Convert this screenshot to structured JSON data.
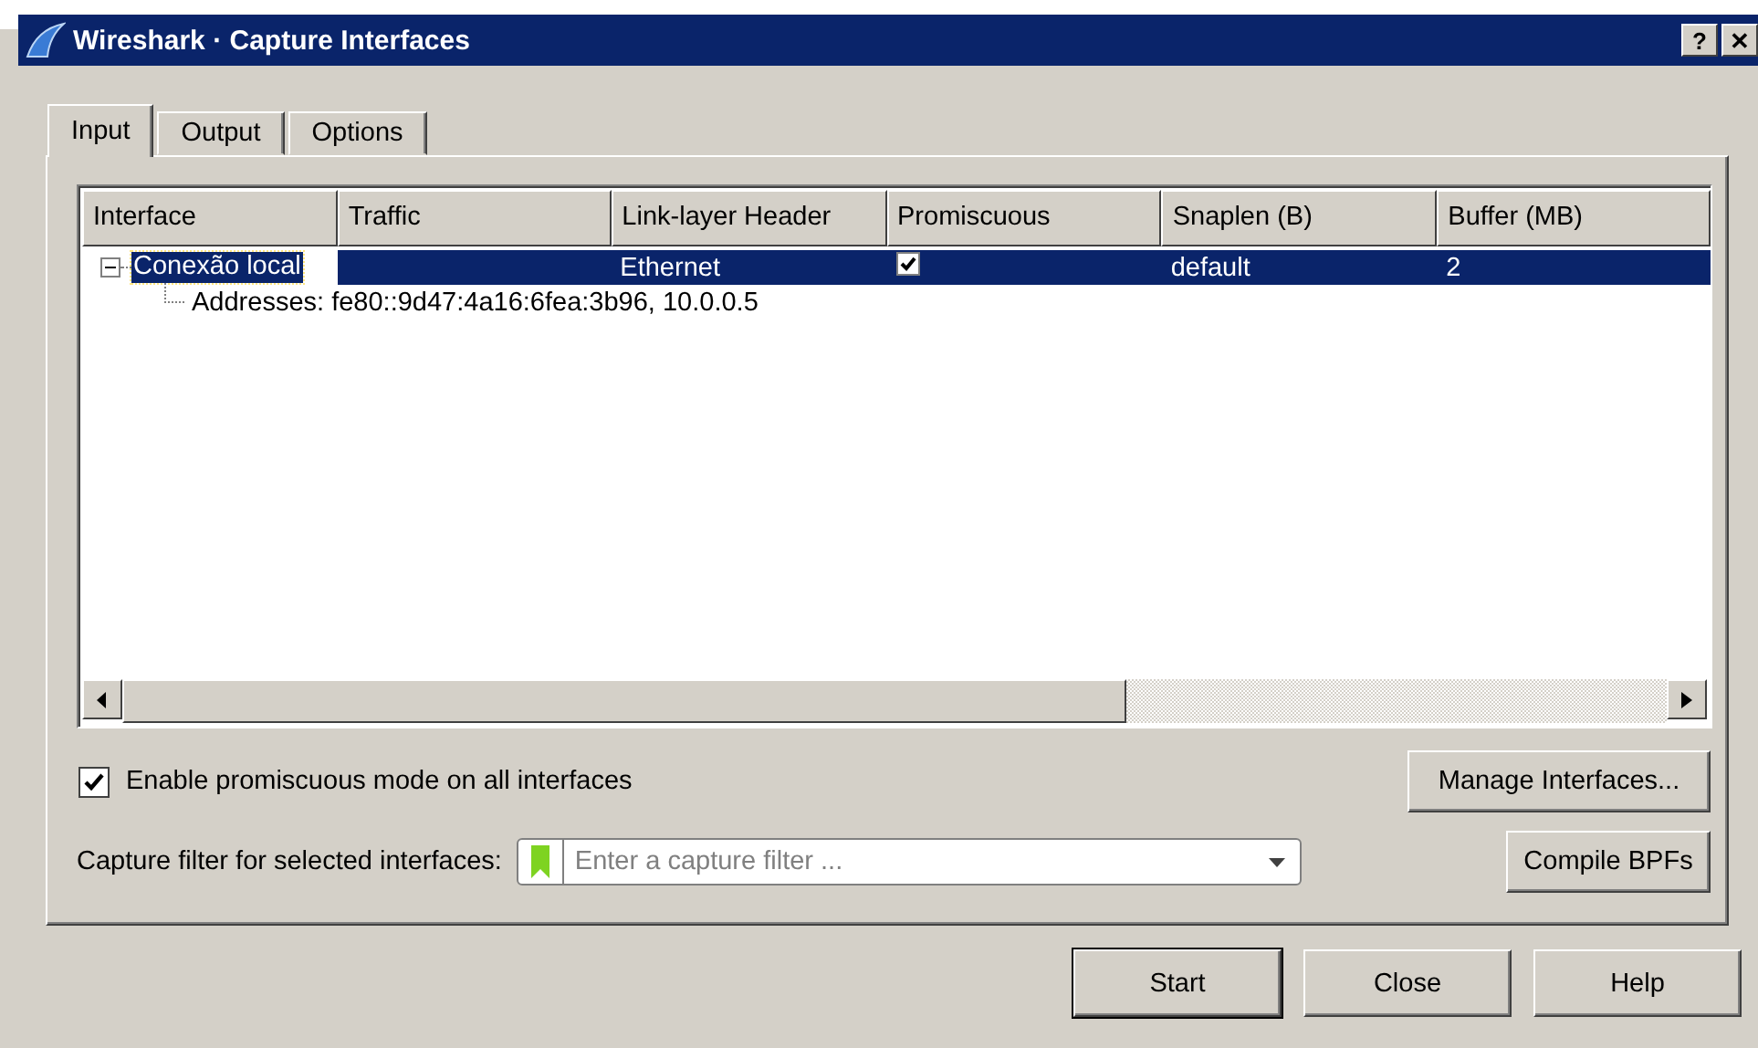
{
  "window": {
    "title": "Wireshark · Capture Interfaces",
    "title_buttons": [
      "?",
      "✕"
    ]
  },
  "tabs": [
    {
      "label": "Input",
      "selected": true
    },
    {
      "label": "Output",
      "selected": false
    },
    {
      "label": "Options",
      "selected": false
    }
  ],
  "table": {
    "columns": [
      "Interface",
      "Traffic",
      "Link-layer Header",
      "Promiscuous",
      "Snaplen (B)",
      "Buffer (MB)"
    ],
    "rows": [
      {
        "interface": "Conexão local",
        "link_layer_header": "Ethernet",
        "promiscuous": true,
        "snaplen": "default",
        "buffer": "2",
        "selected": true,
        "expanded": true,
        "children": [
          {
            "text": "Addresses: fe80::9d47:4a16:6fea:3b96, 10.0.0.5"
          }
        ]
      }
    ]
  },
  "promiscuous_all": {
    "label": "Enable promiscuous mode on all interfaces",
    "checked": true
  },
  "manage_button": "Manage Interfaces...",
  "capture_filter": {
    "label": "Capture filter for selected interfaces:",
    "placeholder": "Enter a capture filter ..."
  },
  "compile_button": "Compile BPFs",
  "buttons": [
    {
      "label": "Start",
      "default": true
    },
    {
      "label": "Close",
      "default": false
    },
    {
      "label": "Help",
      "default": false
    }
  ]
}
